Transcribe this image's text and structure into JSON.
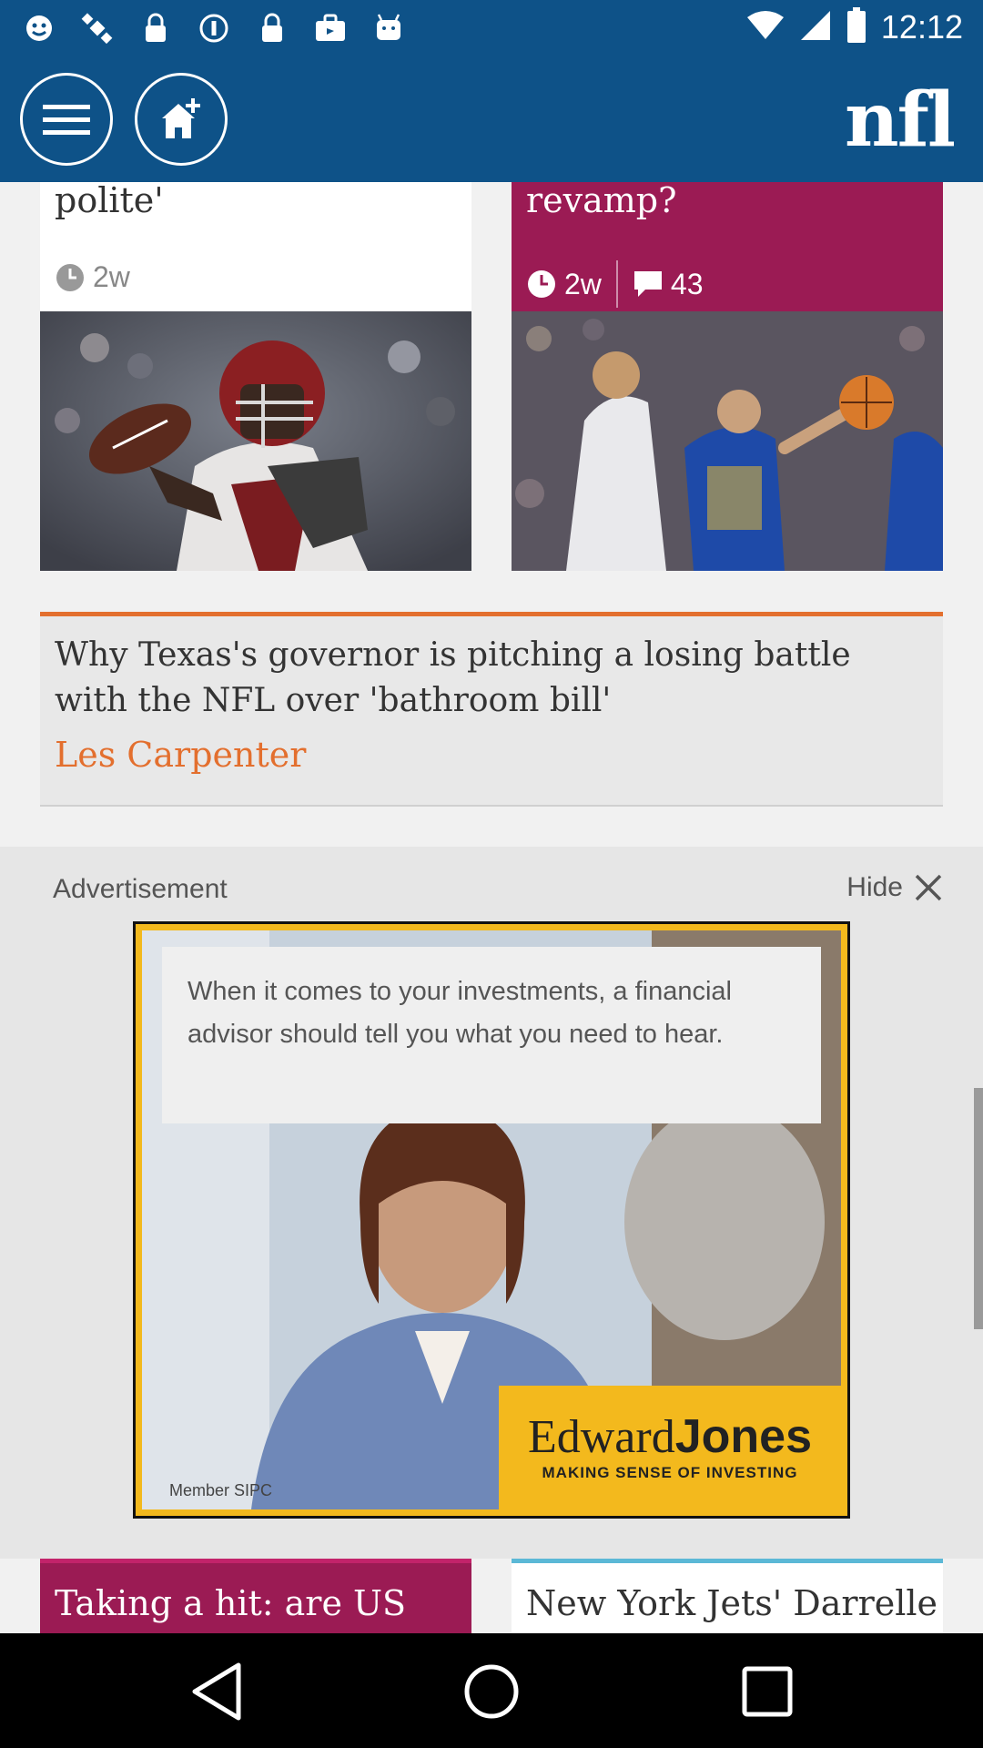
{
  "status_bar": {
    "time": "12:12",
    "icons": [
      "emoji-icon",
      "satellite-icon",
      "lock-icon",
      "info-icon",
      "lock-icon",
      "briefcase-icon",
      "android-icon",
      "wifi-icon",
      "signal-icon",
      "battery-icon"
    ]
  },
  "app_bar": {
    "menu_icon": "menu-icon",
    "home_add_icon": "add-to-home-icon",
    "logo": "nfl"
  },
  "cards_top": [
    {
      "title": "polite'",
      "time": "2w",
      "bg_color": "#ffffff",
      "text_color": "#333333"
    },
    {
      "title": "revamp?",
      "time": "2w",
      "comments": "43",
      "bg_color": "#9b1b54",
      "text_color": "#ffffff"
    }
  ],
  "long_article": {
    "title": "Why Texas's governor is pitching a losing battle with the NFL over 'bathroom bill'",
    "author": "Les Carpenter",
    "accent_color": "#e36f2e"
  },
  "advertisement": {
    "label": "Advertisement",
    "hide_label": "Hide",
    "ad_text": "When it comes to your investments, a financial advisor should tell you what you need to hear.",
    "brand_part1": "Edward",
    "brand_part2": "Jones",
    "tagline": "MAKING SENSE OF INVESTING",
    "sipc": "Member SIPC"
  },
  "cards_bottom": [
    {
      "title": "Taking a hit: are US",
      "bg_color": "#9b1b54",
      "text_color": "#ffffff"
    },
    {
      "title": "New York Jets' Darrelle",
      "bg_color": "#ffffff",
      "accent_color": "#5bb8d6",
      "text_color": "#333333"
    }
  ],
  "nav_bar": {
    "icons": [
      "back-icon",
      "home-icon",
      "recents-icon"
    ]
  }
}
